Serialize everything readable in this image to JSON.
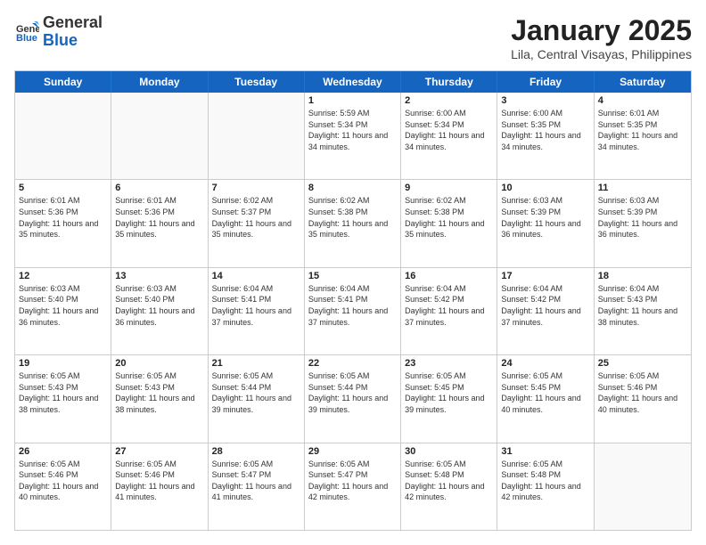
{
  "header": {
    "logo_general": "General",
    "logo_blue": "Blue",
    "month_title": "January 2025",
    "subtitle": "Lila, Central Visayas, Philippines"
  },
  "days_of_week": [
    "Sunday",
    "Monday",
    "Tuesday",
    "Wednesday",
    "Thursday",
    "Friday",
    "Saturday"
  ],
  "weeks": [
    [
      {
        "day": "",
        "sunrise": "",
        "sunset": "",
        "daylight": ""
      },
      {
        "day": "",
        "sunrise": "",
        "sunset": "",
        "daylight": ""
      },
      {
        "day": "",
        "sunrise": "",
        "sunset": "",
        "daylight": ""
      },
      {
        "day": "1",
        "sunrise": "Sunrise: 5:59 AM",
        "sunset": "Sunset: 5:34 PM",
        "daylight": "Daylight: 11 hours and 34 minutes."
      },
      {
        "day": "2",
        "sunrise": "Sunrise: 6:00 AM",
        "sunset": "Sunset: 5:34 PM",
        "daylight": "Daylight: 11 hours and 34 minutes."
      },
      {
        "day": "3",
        "sunrise": "Sunrise: 6:00 AM",
        "sunset": "Sunset: 5:35 PM",
        "daylight": "Daylight: 11 hours and 34 minutes."
      },
      {
        "day": "4",
        "sunrise": "Sunrise: 6:01 AM",
        "sunset": "Sunset: 5:35 PM",
        "daylight": "Daylight: 11 hours and 34 minutes."
      }
    ],
    [
      {
        "day": "5",
        "sunrise": "Sunrise: 6:01 AM",
        "sunset": "Sunset: 5:36 PM",
        "daylight": "Daylight: 11 hours and 35 minutes."
      },
      {
        "day": "6",
        "sunrise": "Sunrise: 6:01 AM",
        "sunset": "Sunset: 5:36 PM",
        "daylight": "Daylight: 11 hours and 35 minutes."
      },
      {
        "day": "7",
        "sunrise": "Sunrise: 6:02 AM",
        "sunset": "Sunset: 5:37 PM",
        "daylight": "Daylight: 11 hours and 35 minutes."
      },
      {
        "day": "8",
        "sunrise": "Sunrise: 6:02 AM",
        "sunset": "Sunset: 5:38 PM",
        "daylight": "Daylight: 11 hours and 35 minutes."
      },
      {
        "day": "9",
        "sunrise": "Sunrise: 6:02 AM",
        "sunset": "Sunset: 5:38 PM",
        "daylight": "Daylight: 11 hours and 35 minutes."
      },
      {
        "day": "10",
        "sunrise": "Sunrise: 6:03 AM",
        "sunset": "Sunset: 5:39 PM",
        "daylight": "Daylight: 11 hours and 36 minutes."
      },
      {
        "day": "11",
        "sunrise": "Sunrise: 6:03 AM",
        "sunset": "Sunset: 5:39 PM",
        "daylight": "Daylight: 11 hours and 36 minutes."
      }
    ],
    [
      {
        "day": "12",
        "sunrise": "Sunrise: 6:03 AM",
        "sunset": "Sunset: 5:40 PM",
        "daylight": "Daylight: 11 hours and 36 minutes."
      },
      {
        "day": "13",
        "sunrise": "Sunrise: 6:03 AM",
        "sunset": "Sunset: 5:40 PM",
        "daylight": "Daylight: 11 hours and 36 minutes."
      },
      {
        "day": "14",
        "sunrise": "Sunrise: 6:04 AM",
        "sunset": "Sunset: 5:41 PM",
        "daylight": "Daylight: 11 hours and 37 minutes."
      },
      {
        "day": "15",
        "sunrise": "Sunrise: 6:04 AM",
        "sunset": "Sunset: 5:41 PM",
        "daylight": "Daylight: 11 hours and 37 minutes."
      },
      {
        "day": "16",
        "sunrise": "Sunrise: 6:04 AM",
        "sunset": "Sunset: 5:42 PM",
        "daylight": "Daylight: 11 hours and 37 minutes."
      },
      {
        "day": "17",
        "sunrise": "Sunrise: 6:04 AM",
        "sunset": "Sunset: 5:42 PM",
        "daylight": "Daylight: 11 hours and 37 minutes."
      },
      {
        "day": "18",
        "sunrise": "Sunrise: 6:04 AM",
        "sunset": "Sunset: 5:43 PM",
        "daylight": "Daylight: 11 hours and 38 minutes."
      }
    ],
    [
      {
        "day": "19",
        "sunrise": "Sunrise: 6:05 AM",
        "sunset": "Sunset: 5:43 PM",
        "daylight": "Daylight: 11 hours and 38 minutes."
      },
      {
        "day": "20",
        "sunrise": "Sunrise: 6:05 AM",
        "sunset": "Sunset: 5:43 PM",
        "daylight": "Daylight: 11 hours and 38 minutes."
      },
      {
        "day": "21",
        "sunrise": "Sunrise: 6:05 AM",
        "sunset": "Sunset: 5:44 PM",
        "daylight": "Daylight: 11 hours and 39 minutes."
      },
      {
        "day": "22",
        "sunrise": "Sunrise: 6:05 AM",
        "sunset": "Sunset: 5:44 PM",
        "daylight": "Daylight: 11 hours and 39 minutes."
      },
      {
        "day": "23",
        "sunrise": "Sunrise: 6:05 AM",
        "sunset": "Sunset: 5:45 PM",
        "daylight": "Daylight: 11 hours and 39 minutes."
      },
      {
        "day": "24",
        "sunrise": "Sunrise: 6:05 AM",
        "sunset": "Sunset: 5:45 PM",
        "daylight": "Daylight: 11 hours and 40 minutes."
      },
      {
        "day": "25",
        "sunrise": "Sunrise: 6:05 AM",
        "sunset": "Sunset: 5:46 PM",
        "daylight": "Daylight: 11 hours and 40 minutes."
      }
    ],
    [
      {
        "day": "26",
        "sunrise": "Sunrise: 6:05 AM",
        "sunset": "Sunset: 5:46 PM",
        "daylight": "Daylight: 11 hours and 40 minutes."
      },
      {
        "day": "27",
        "sunrise": "Sunrise: 6:05 AM",
        "sunset": "Sunset: 5:46 PM",
        "daylight": "Daylight: 11 hours and 41 minutes."
      },
      {
        "day": "28",
        "sunrise": "Sunrise: 6:05 AM",
        "sunset": "Sunset: 5:47 PM",
        "daylight": "Daylight: 11 hours and 41 minutes."
      },
      {
        "day": "29",
        "sunrise": "Sunrise: 6:05 AM",
        "sunset": "Sunset: 5:47 PM",
        "daylight": "Daylight: 11 hours and 42 minutes."
      },
      {
        "day": "30",
        "sunrise": "Sunrise: 6:05 AM",
        "sunset": "Sunset: 5:48 PM",
        "daylight": "Daylight: 11 hours and 42 minutes."
      },
      {
        "day": "31",
        "sunrise": "Sunrise: 6:05 AM",
        "sunset": "Sunset: 5:48 PM",
        "daylight": "Daylight: 11 hours and 42 minutes."
      },
      {
        "day": "",
        "sunrise": "",
        "sunset": "",
        "daylight": ""
      }
    ]
  ]
}
